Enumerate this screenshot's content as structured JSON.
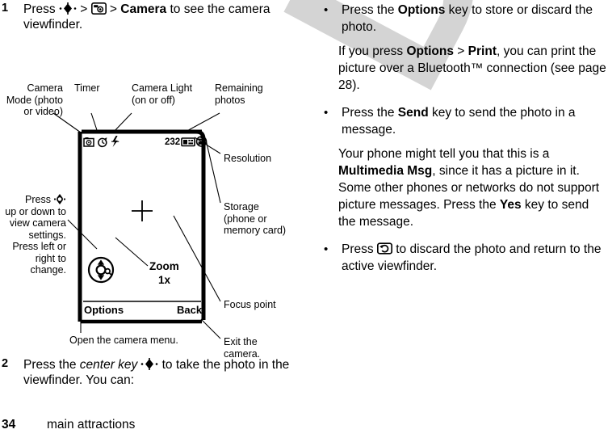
{
  "page": {
    "number": "34",
    "footer_title": "main attractions",
    "watermark": "DRAFT",
    "watermark_color": "#d4d4d4",
    "background": "#ffffff",
    "text_color": "#000000"
  },
  "left_column": {
    "step1": {
      "number": "1",
      "text_a": "Press ",
      "icon_center_key": "center-key-icon",
      "text_b": " > ",
      "icon_camera": "camera-key-icon",
      "text_c": " > ",
      "bold_camera": "Camera",
      "text_d": " to see the camera viewfinder."
    },
    "step2": {
      "number": "2",
      "text_a": "Press the ",
      "italic_center_key": "center key",
      "icon_center_key": "center-key-icon",
      "text_b": " to take the photo in the viewfinder. You can:"
    }
  },
  "diagram": {
    "callouts": {
      "camera_mode": "Camera Mode (photo or video)",
      "camera_mode_lines": [
        "Camera",
        "Mode (photo",
        "or video)"
      ],
      "timer": "Timer",
      "camera_light": "Camera Light (on or off)",
      "camera_light_lines": [
        "Camera Light",
        "(on or off)"
      ],
      "remaining_photos": "Remaining photos",
      "remaining_photos_lines": [
        "Remaining",
        "photos"
      ],
      "resolution": "Resolution",
      "storage": "Storage (phone or memory card)",
      "storage_lines": [
        "Storage",
        "(phone or",
        "memory card)"
      ],
      "focus_point": "Focus point",
      "exit_camera": "Exit the camera.",
      "exit_camera_lines": [
        "Exit the",
        "camera."
      ],
      "press_nav": "Press up or down to view camera settings. Press left or right to change.",
      "press_nav_lines": [
        "Press",
        "up or down to",
        "view camera",
        "settings.",
        "Press left or",
        "right to",
        "change."
      ],
      "open_menu": "Open the camera menu."
    },
    "phone_screen": {
      "status_icons": [
        "camera-mode-icon",
        "timer-icon",
        "camera-light-icon"
      ],
      "remaining_count": "232",
      "resolution_icon": "resolution-icon",
      "storage_icon": "storage-icon",
      "focus_point_icon": "focus-crosshair-icon",
      "nav_key_icon": "nav-key-zoom-icon",
      "zoom_label": "Zoom",
      "zoom_value": "1x",
      "softkey_left": "Options",
      "softkey_right": "Back"
    }
  },
  "right_column": {
    "bullets": [
      {
        "dot": "•",
        "text_a": "Press the ",
        "bold_1": "Options",
        "text_b": " key to store or discard the photo.",
        "sub_para": {
          "text_a": "If you press ",
          "bold_1": "Options",
          "text_b": " > ",
          "bold_2": "Print",
          "text_c": ", you can print the picture over a Bluetooth™ connection (see page 28)."
        }
      },
      {
        "dot": "•",
        "text_a": "Press the ",
        "bold_1": "Send",
        "text_b": " key to send the photo in a message.",
        "sub_para": {
          "text_a": "Your phone might tell you that this is a ",
          "bold_1": "Multimedia Msg",
          "text_b": ", since it has a picture in it. Some other phones or networks do not support picture messages. Press the ",
          "bold_2": "Yes",
          "text_c": " key to send the message."
        }
      },
      {
        "dot": "•",
        "text_a": "Press ",
        "icon_back_key": "back-key-icon",
        "text_b": " to discard the photo and return to the active viewfinder."
      }
    ]
  }
}
